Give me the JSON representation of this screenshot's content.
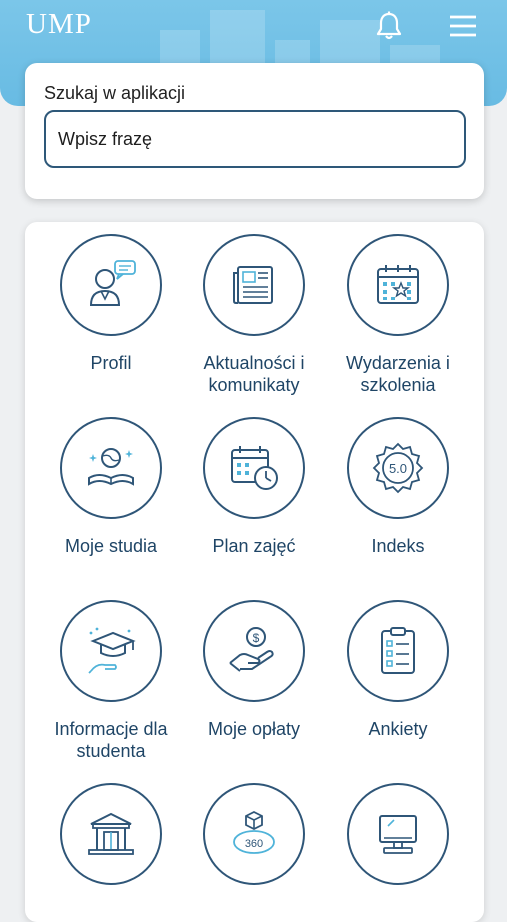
{
  "header": {
    "logo": "UMP",
    "bell_icon": "bell-icon",
    "menu_icon": "hamburger-menu-icon"
  },
  "search": {
    "label": "Szukaj w aplikacji",
    "placeholder": "Wpisz frazę"
  },
  "tiles": [
    {
      "label_1": "Profil",
      "label_2": "",
      "icon": "user-chat-icon"
    },
    {
      "label_1": "Aktualności i",
      "label_2": "komunikaty",
      "icon": "newspaper-icon"
    },
    {
      "label_1": "Wydarzenia i",
      "label_2": "szkolenia",
      "icon": "calendar-star-icon"
    },
    {
      "label_1": "Moje studia",
      "label_2": "",
      "icon": "book-globe-icon"
    },
    {
      "label_1": "Plan zajęć",
      "label_2": "",
      "icon": "calendar-clock-icon"
    },
    {
      "label_1": "Indeks",
      "label_2": "",
      "icon": "grade-badge-icon",
      "badge_text": "5.0"
    },
    {
      "label_1": "Informacje dla",
      "label_2": "studenta",
      "icon": "graduation-cap-hand-icon"
    },
    {
      "label_1": "Moje opłaty",
      "label_2": "",
      "icon": "coin-hand-icon"
    },
    {
      "label_1": "Ankiety",
      "label_2": "",
      "icon": "clipboard-checklist-icon"
    },
    {
      "label_1": "",
      "label_2": "",
      "icon": "library-building-icon"
    },
    {
      "label_1": "",
      "label_2": "",
      "icon": "virtual-tour-360-icon",
      "badge_text": "360"
    },
    {
      "label_1": "",
      "label_2": "",
      "icon": "computer-icon"
    }
  ],
  "colors": {
    "header_blue": "#6fbfe6",
    "icon_navy": "#2f5678",
    "icon_accent": "#4fb3d9"
  }
}
